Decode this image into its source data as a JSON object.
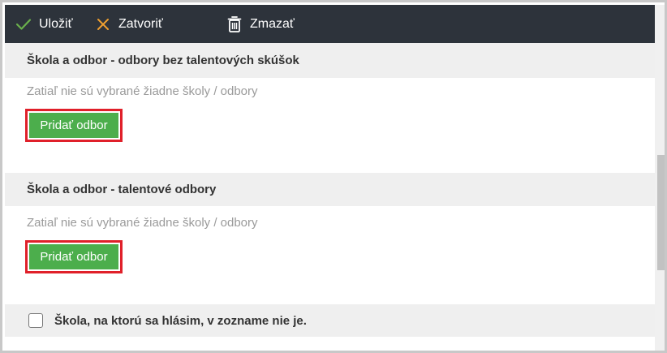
{
  "toolbar": {
    "save_label": "Uložiť",
    "close_label": "Zatvoriť",
    "delete_label": "Zmazať"
  },
  "sections": [
    {
      "title": "Škola a odbor - odbory bez talentových skúšok",
      "placeholder": "Zatiaľ nie sú vybrané žiadne školy / odbory",
      "add_label": "Pridať odbor"
    },
    {
      "title": "Škola a odbor - talentové odbory",
      "placeholder": "Zatiaľ nie sú vybrané žiadne školy / odbory",
      "add_label": "Pridať odbor"
    }
  ],
  "school_not_listed": {
    "label": "Škola, na ktorú sa hlásim, v zozname nie je.",
    "checked": false
  },
  "colors": {
    "toolbar_bg": "#2d333b",
    "save_icon": "#6ab04c",
    "close_icon": "#f0a030",
    "add_button": "#4cae4c",
    "highlight": "#e0202a"
  },
  "icons": {
    "save": "check-icon",
    "close": "close-icon",
    "delete": "trash-icon"
  }
}
